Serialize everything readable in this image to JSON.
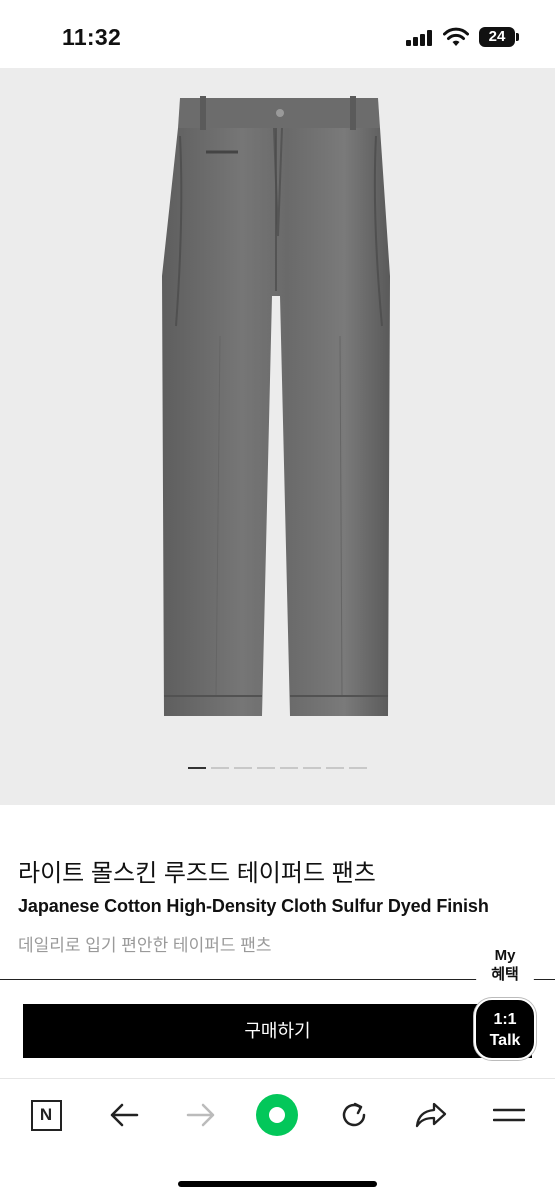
{
  "status_bar": {
    "time": "11:32",
    "battery": "24",
    "icons": [
      "signal-icon",
      "wifi-icon",
      "battery-icon"
    ]
  },
  "gallery": {
    "image": "grey-loose-tapered-pants",
    "slide_count": 8,
    "active_slide": 1
  },
  "product": {
    "title_ko": "라이트 몰스킨 루즈드 테이퍼드 팬츠",
    "title_en": "Japanese Cotton High-Density Cloth Sulfur Dyed Finish",
    "subtitle": "데일리로 입기 편안한 테이퍼드 팬츠"
  },
  "floating": {
    "my_benefit_line1": "My",
    "my_benefit_line2": "혜택",
    "talk_line1": "1:1",
    "talk_line2": "Talk"
  },
  "actions": {
    "buy_label": "구매하기"
  },
  "bottom_nav": {
    "items": [
      "naver-n-icon",
      "back-arrow-icon",
      "forward-arrow-icon",
      "green-dot-icon",
      "refresh-icon",
      "share-icon",
      "menu-icon"
    ],
    "n_label": "N",
    "accent_color": "#03c75a"
  }
}
